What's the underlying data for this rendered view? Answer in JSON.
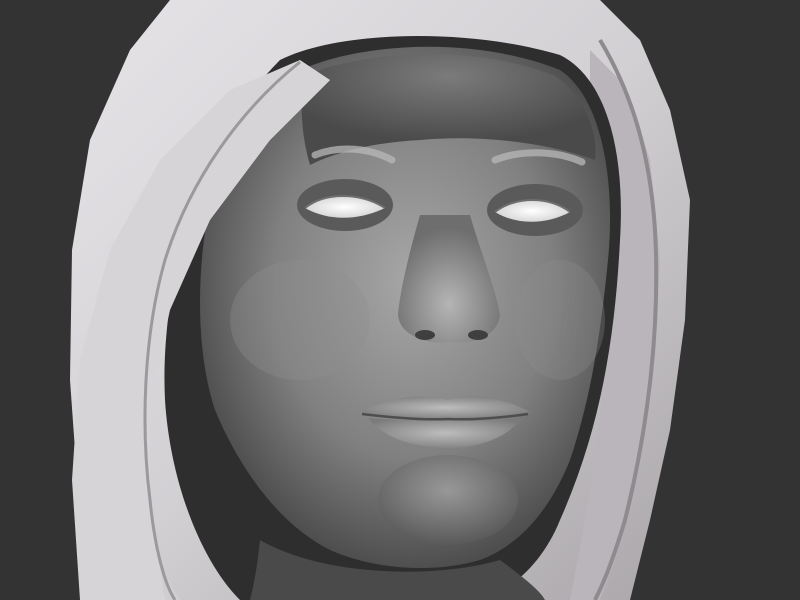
{
  "scene": {
    "background_color": "#333333",
    "hood_color": "#d7d5d8",
    "hood_shadow_color": "#8e8a8e",
    "skin_color": "#8a8a8a",
    "skin_highlight_color": "#c4c4c4",
    "skin_shadow_color": "#3e3e3e",
    "eye_color": "#efefef"
  }
}
